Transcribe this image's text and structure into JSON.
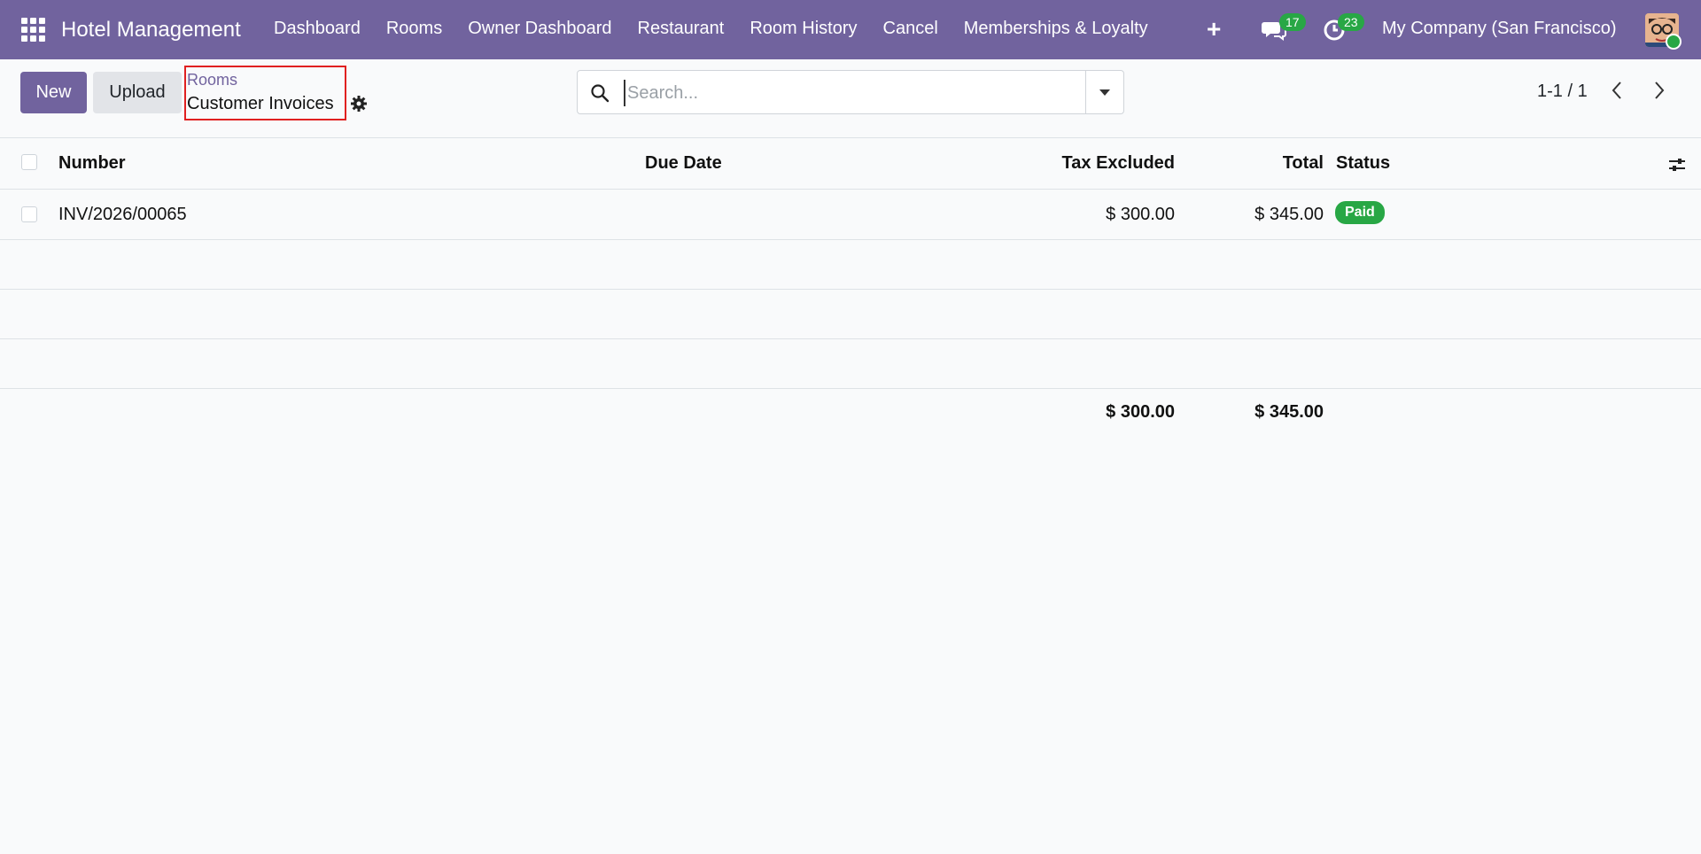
{
  "navbar": {
    "app_title": "Hotel Management",
    "menu": [
      "Dashboard",
      "Rooms",
      "Owner Dashboard",
      "Restaurant",
      "Room History",
      "Cancel",
      "Memberships & Loyalty"
    ],
    "chat_count": "17",
    "activity_count": "23",
    "company": "My Company (San Francisco)",
    "bg_color": "#71639e"
  },
  "control": {
    "new_label": "New",
    "upload_label": "Upload",
    "breadcrumb_parent": "Rooms",
    "breadcrumb_current": "Customer Invoices",
    "search_placeholder": "Search...",
    "pager": "1-1 / 1"
  },
  "list": {
    "headers": {
      "number": "Number",
      "due_date": "Due Date",
      "tax_excluded": "Tax Excluded",
      "total": "Total",
      "status": "Status"
    },
    "rows": [
      {
        "number": "INV/2026/00065",
        "due_date": "",
        "tax_excluded": "$ 300.00",
        "total": "$ 345.00",
        "status": "Paid"
      }
    ],
    "footer": {
      "tax_excluded": "$ 300.00",
      "total": "$ 345.00"
    }
  },
  "colors": {
    "accent": "#71639e",
    "paid": "#28a745"
  }
}
